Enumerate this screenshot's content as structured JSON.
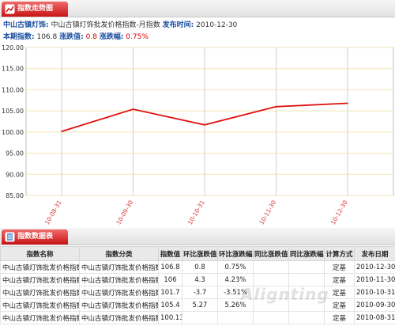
{
  "trend_section": {
    "title": "指数走势图"
  },
  "info": {
    "name_label": "中山古镇灯饰:",
    "name_value": "中山古镇灯饰批发价格指数-月指数",
    "time_label": "发布时间:",
    "time_value": "2010-12-30",
    "period_label": "本期指数:",
    "period_value": "106.8",
    "change_label": "涨跌值:",
    "change_value": "0.8",
    "pct_label": "涨跌幅:",
    "pct_value": "0.75%"
  },
  "chart_data": {
    "type": "line",
    "categories": [
      "10-08-31",
      "10-09-30",
      "10-10-31",
      "10-11-30",
      "10-12-30"
    ],
    "series": [
      {
        "values": [
          100.13,
          105.4,
          101.7,
          106,
          106.8
        ],
        "color": "#dd1111"
      }
    ],
    "yticks": [
      "120.00",
      "115.00",
      "110.00",
      "105.00",
      "100.00",
      "95.00",
      "90.00",
      "85.00"
    ],
    "ylim": [
      85,
      120
    ],
    "grid": true
  },
  "table_section": {
    "title": "指数数据表"
  },
  "table": {
    "headers": [
      "指数名称",
      "指数分类",
      "指数值",
      "环比涨跌值",
      "环比涨跌幅",
      "同比涨跌值",
      "同比涨跌幅",
      "计算方式",
      "发布日期"
    ],
    "rows": [
      [
        "中山古镇灯饰批发价格指数",
        "中山古镇灯饰批发价格指数",
        "106.8",
        "0.8",
        "0.75%",
        "",
        "",
        "定基",
        "2010-12-30"
      ],
      [
        "中山古镇灯饰批发价格指数",
        "中山古镇灯饰批发价格指数",
        "106",
        "4.3",
        "4.23%",
        "",
        "",
        "定基",
        "2010-11-30"
      ],
      [
        "中山古镇灯饰批发价格指数",
        "中山古镇灯饰批发价格指数",
        "101.7",
        "-3.7",
        "-3.51%",
        "",
        "",
        "定基",
        "2010-10-31"
      ],
      [
        "中山古镇灯饰批发价格指数",
        "中山古镇灯饰批发价格指数",
        "105.4",
        "5.27",
        "5.26%",
        "",
        "",
        "定基",
        "2010-09-30"
      ],
      [
        "中山古镇灯饰批发价格指数",
        "中山古镇灯饰批发价格指数",
        "100.13",
        "",
        "",
        "",
        "",
        "定基",
        "2010-08-31"
      ]
    ]
  },
  "watermark": "Alignting",
  "icons": {
    "trend_tab": "chart-icon",
    "table_tab": "table-icon"
  }
}
